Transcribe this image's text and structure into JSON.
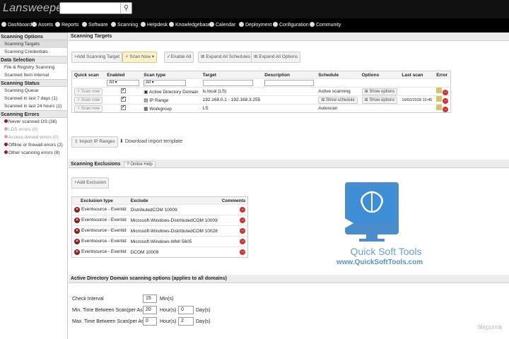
{
  "app": {
    "logo": "Lansweeper",
    "search_placeholder": ""
  },
  "nav": [
    {
      "label": "Dashboard",
      "icon": "dashboard-icon"
    },
    {
      "label": "Assets",
      "icon": "assets-icon"
    },
    {
      "label": "Reports",
      "icon": "reports-icon"
    },
    {
      "label": "Software",
      "icon": "software-icon"
    },
    {
      "label": "Scanning",
      "icon": "scanning-icon"
    },
    {
      "label": "Helpdesk",
      "icon": "helpdesk-icon"
    },
    {
      "label": "Knowledgebase",
      "icon": "knowledgebase-icon"
    },
    {
      "label": "Calendar",
      "icon": "calendar-icon"
    },
    {
      "label": "Deployment",
      "icon": "deployment-icon"
    },
    {
      "label": "Configuration",
      "icon": "configuration-icon"
    },
    {
      "label": "Community",
      "icon": "community-icon"
    }
  ],
  "sidebar": {
    "scanning_options": {
      "title": "Scanning Options",
      "items": [
        "Scanning Targets",
        "Scanning Credentials"
      ]
    },
    "data_selection": {
      "title": "Data Selection",
      "items": [
        "File & Registry Scanning",
        "Scanned Item Interval"
      ]
    },
    "scanning_status": {
      "title": "Scanning Status",
      "items": [
        "Scanning Queue",
        "Scanned in last 7 days (1)",
        "Scanned in last 24 hours (1)"
      ]
    },
    "scanning_errors": {
      "title": "Scanning Errors",
      "items": [
        "Never scanned OS (38)",
        "LDS errors (0)",
        "Access denied errors (0)",
        "Offline or firewall errors (2)",
        "Other scanning errors (8)"
      ]
    }
  },
  "targets": {
    "title": "Scanning Targets",
    "buttons": {
      "add": "Add Scanning Target",
      "scan_now": "Scan Now",
      "enable_all": "Enable All",
      "expand_schedules": "Expand All Schedules",
      "expand_options": "Expand All Options"
    },
    "columns": [
      "Quick scan",
      "Enabled",
      "Scan type",
      "Target",
      "Description",
      "Schedule",
      "Options",
      "Last scan",
      "Error"
    ],
    "filter_all": "All",
    "scan_now_label": "Scan now",
    "rows": [
      {
        "scan_type": "Active Directory Domain",
        "target": "ls.local (LS)",
        "description": "",
        "schedule": "Active scanning",
        "options": "Show options",
        "last_scan": ""
      },
      {
        "scan_type": "IP Range",
        "target": "192.168.0.1 - 192.168.3.255",
        "description": "",
        "schedule": "Show schedule",
        "options": "Show options",
        "last_scan": "16/02/2018 10:45"
      },
      {
        "scan_type": "Workgroup",
        "target": "LS",
        "description": "",
        "schedule": "Autoscan",
        "options": "",
        "last_scan": ""
      }
    ],
    "import_ip": "Import IP Ranges",
    "download_template": "Download import template"
  },
  "exclusions": {
    "title": "Scanning Exclusions",
    "help": "Online Help",
    "add": "Add Exclusion",
    "columns": [
      "Exclusion type",
      "Exclude",
      "Comments"
    ],
    "rows": [
      {
        "type": "Eventsource - Eventid",
        "exclude": "DistributedCOM 10009"
      },
      {
        "type": "Eventsource - Eventid",
        "exclude": "Microsoft-Windows-DistributedCOM 10009"
      },
      {
        "type": "Eventsource - Eventid",
        "exclude": "Microsoft-Windows-DistributedCOM 10028"
      },
      {
        "type": "Eventsource - Eventid",
        "exclude": "Microsoft-Windows-WMI 5605"
      },
      {
        "type": "Eventsource - Eventid",
        "exclude": "DCOM 10009"
      }
    ]
  },
  "ad_options": {
    "title": "Active Directory Domain scanning options (applies to all domains)",
    "check_interval": {
      "label": "Check Interval",
      "value": "15",
      "unit": "Min(s)"
    },
    "min_between": {
      "label": "Min. Time Between Scan(per Asset)",
      "hours": "20",
      "hours_unit": "Hour(s)",
      "days": "0",
      "days_unit": "Day(s)"
    },
    "max_between": {
      "label": "Max. Time Between Scan(per Asset)",
      "hours": "0",
      "hours_unit": "Hour(s)",
      "days": "2",
      "days_unit": "Day(s)"
    }
  },
  "watermark": {
    "name": "Quick Soft Tools",
    "url": "www.QuickSoftTools.com",
    "corner": "filepuma"
  },
  "colors": {
    "topbar": "#111111",
    "navbar": "#000000",
    "accent_blue": "#2b78c2",
    "delete_red": "#cc3333"
  }
}
